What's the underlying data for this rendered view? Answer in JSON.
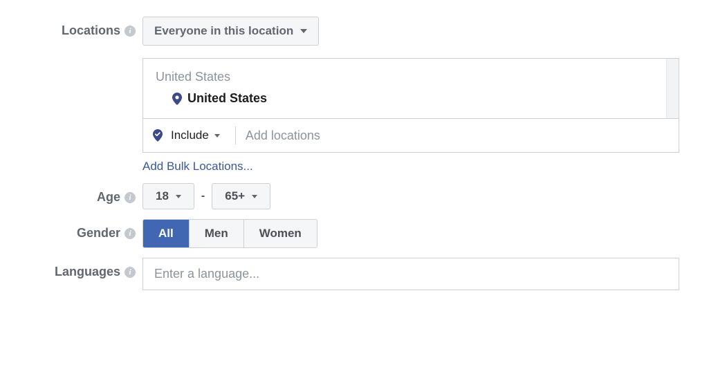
{
  "labels": {
    "locations": "Locations",
    "age": "Age",
    "gender": "Gender",
    "languages": "Languages"
  },
  "locations": {
    "scope_dropdown": "Everyone in this location",
    "group_label": "United States",
    "selected_item": "United States",
    "include_label": "Include",
    "add_placeholder": "Add locations",
    "bulk_link": "Add Bulk Locations..."
  },
  "age": {
    "min": "18",
    "separator": "-",
    "max": "65+"
  },
  "gender": {
    "options": {
      "all": "All",
      "men": "Men",
      "women": "Women"
    },
    "active": "all"
  },
  "languages": {
    "placeholder": "Enter a language..."
  }
}
